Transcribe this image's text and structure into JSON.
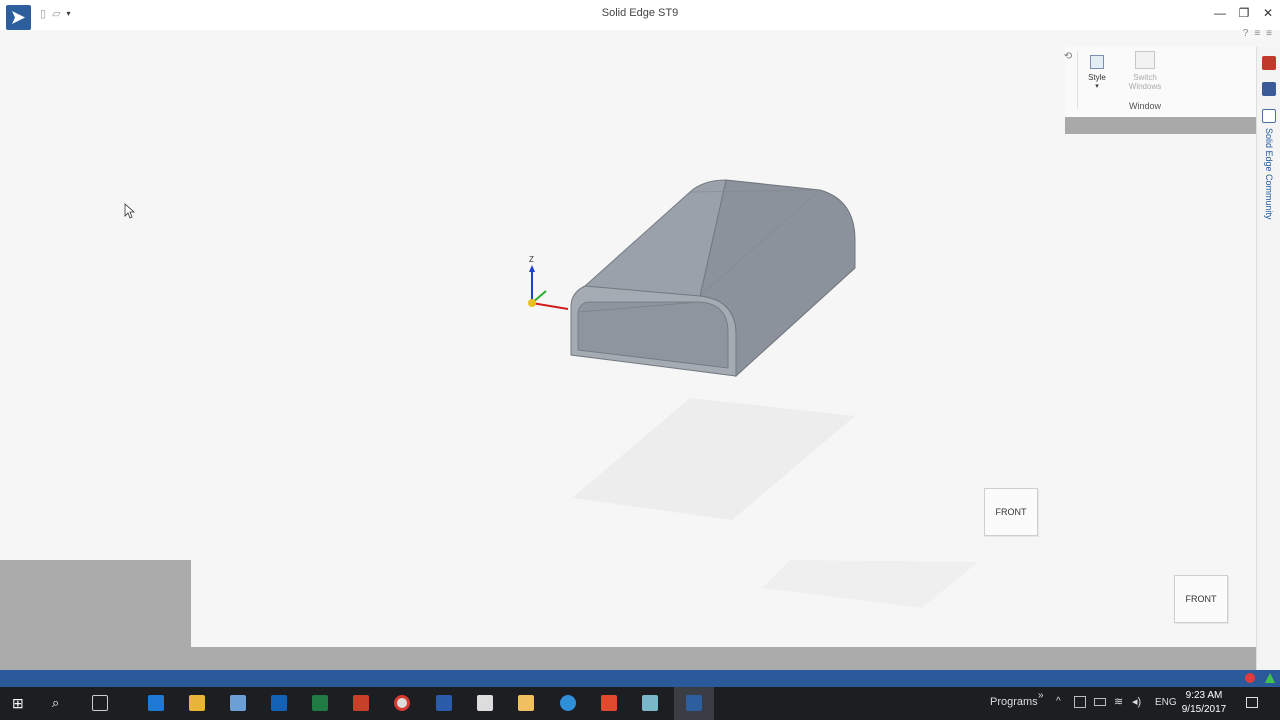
{
  "app": {
    "title": "Solid Edge ST9",
    "window_controls": [
      "minimize",
      "restore",
      "close"
    ]
  },
  "ribbon": {
    "style_label": "Style",
    "switch_label": "Switch Windows",
    "group_label": "Window"
  },
  "sidepanel": {
    "community_label": "Solid Edge Community"
  },
  "viewport": {
    "triad_z": "Z",
    "navcube_main_label": "FRONT",
    "navcube_secondary_label": "FRONT"
  },
  "taskbar": {
    "programs_label": "Programs",
    "lang": "ENG",
    "time": "9:23 AM",
    "date": "9/15/2017"
  }
}
